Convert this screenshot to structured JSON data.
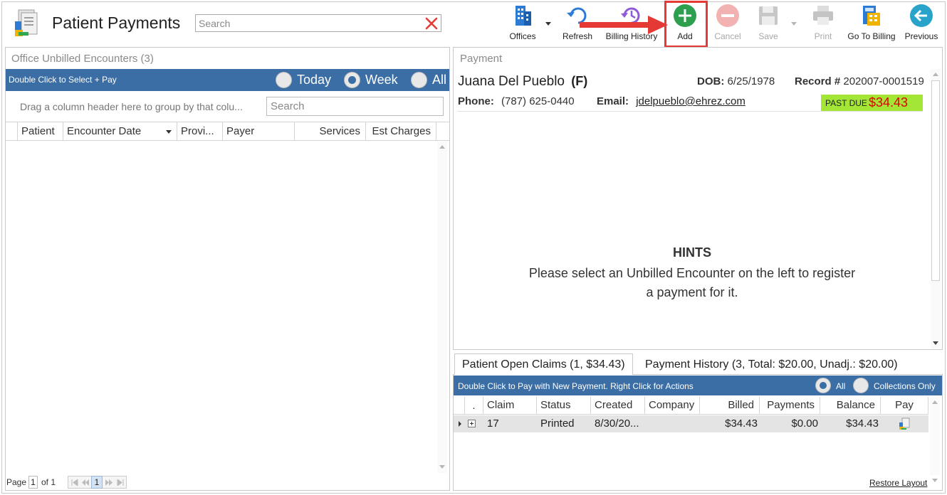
{
  "header": {
    "title": "Patient Payments",
    "search_placeholder": "Search"
  },
  "toolbar": {
    "offices": "Offices",
    "refresh": "Refresh",
    "billing_history": "Billing History",
    "add": "Add",
    "cancel": "Cancel",
    "save": "Save",
    "print": "Print",
    "go_to_billing": "Go To Billing",
    "previous": "Previous"
  },
  "left_panel": {
    "caption": "Office Unbilled Encounters (3)",
    "bar_text": "Double Click to Select + Pay",
    "filters": [
      {
        "label": "Today",
        "selected": false
      },
      {
        "label": "Week",
        "selected": true
      },
      {
        "label": "All",
        "selected": false
      }
    ],
    "group_hint": "Drag a column header here to group by that colu...",
    "search_placeholder": "Search",
    "columns": [
      "Patient",
      "Encounter Date",
      "Provi...",
      "Payer",
      "Services",
      "Est Charges"
    ],
    "pager": {
      "page_label": "Page",
      "page_value": "1",
      "of_label": "of 1",
      "current": "1"
    }
  },
  "payment": {
    "caption": "Payment",
    "patient_name": "Juana Del Pueblo",
    "gender": "(F)",
    "dob_label": "DOB:",
    "dob": "6/25/1978",
    "record_label": "Record #",
    "record": "202007-0001519",
    "phone_label": "Phone:",
    "phone": "(787) 625-0440",
    "email_label": "Email:",
    "email": "jdelpueblo@ehrez.com",
    "past_due_label": "PAST DUE",
    "past_due_amount": "$34.43",
    "hints_title": "HINTS",
    "hints_text": "Please select an Unbilled Encounter on the left to register a payment for it."
  },
  "claims": {
    "tabs": [
      {
        "label": "Patient Open Claims (1, $34.43)",
        "active": true
      },
      {
        "label": "Payment History (3, Total: $20.00, Unadj.: $20.00)",
        "active": false
      }
    ],
    "bar_text": "Double Click to Pay with New Payment. Right Click for Actions",
    "filters": [
      {
        "label": "All",
        "selected": true
      },
      {
        "label": "Collections Only",
        "selected": false
      }
    ],
    "dot_col": ".",
    "columns": [
      "Claim",
      "Status",
      "Created",
      "Company",
      "Billed",
      "Payments",
      "Balance",
      "Pay"
    ],
    "rows": [
      {
        "claim": "17",
        "status": "Printed",
        "created": "8/30/20...",
        "company": "",
        "billed": "$34.43",
        "payments": "$0.00",
        "balance": "$34.43"
      }
    ],
    "restore_layout": "Restore Layout"
  },
  "colors": {
    "accent_blue": "#3a6ea5",
    "add_green": "#2e9e4f",
    "highlight_red": "#e53935",
    "past_due_bg": "#a3e635",
    "past_due_text": "#e00000"
  }
}
